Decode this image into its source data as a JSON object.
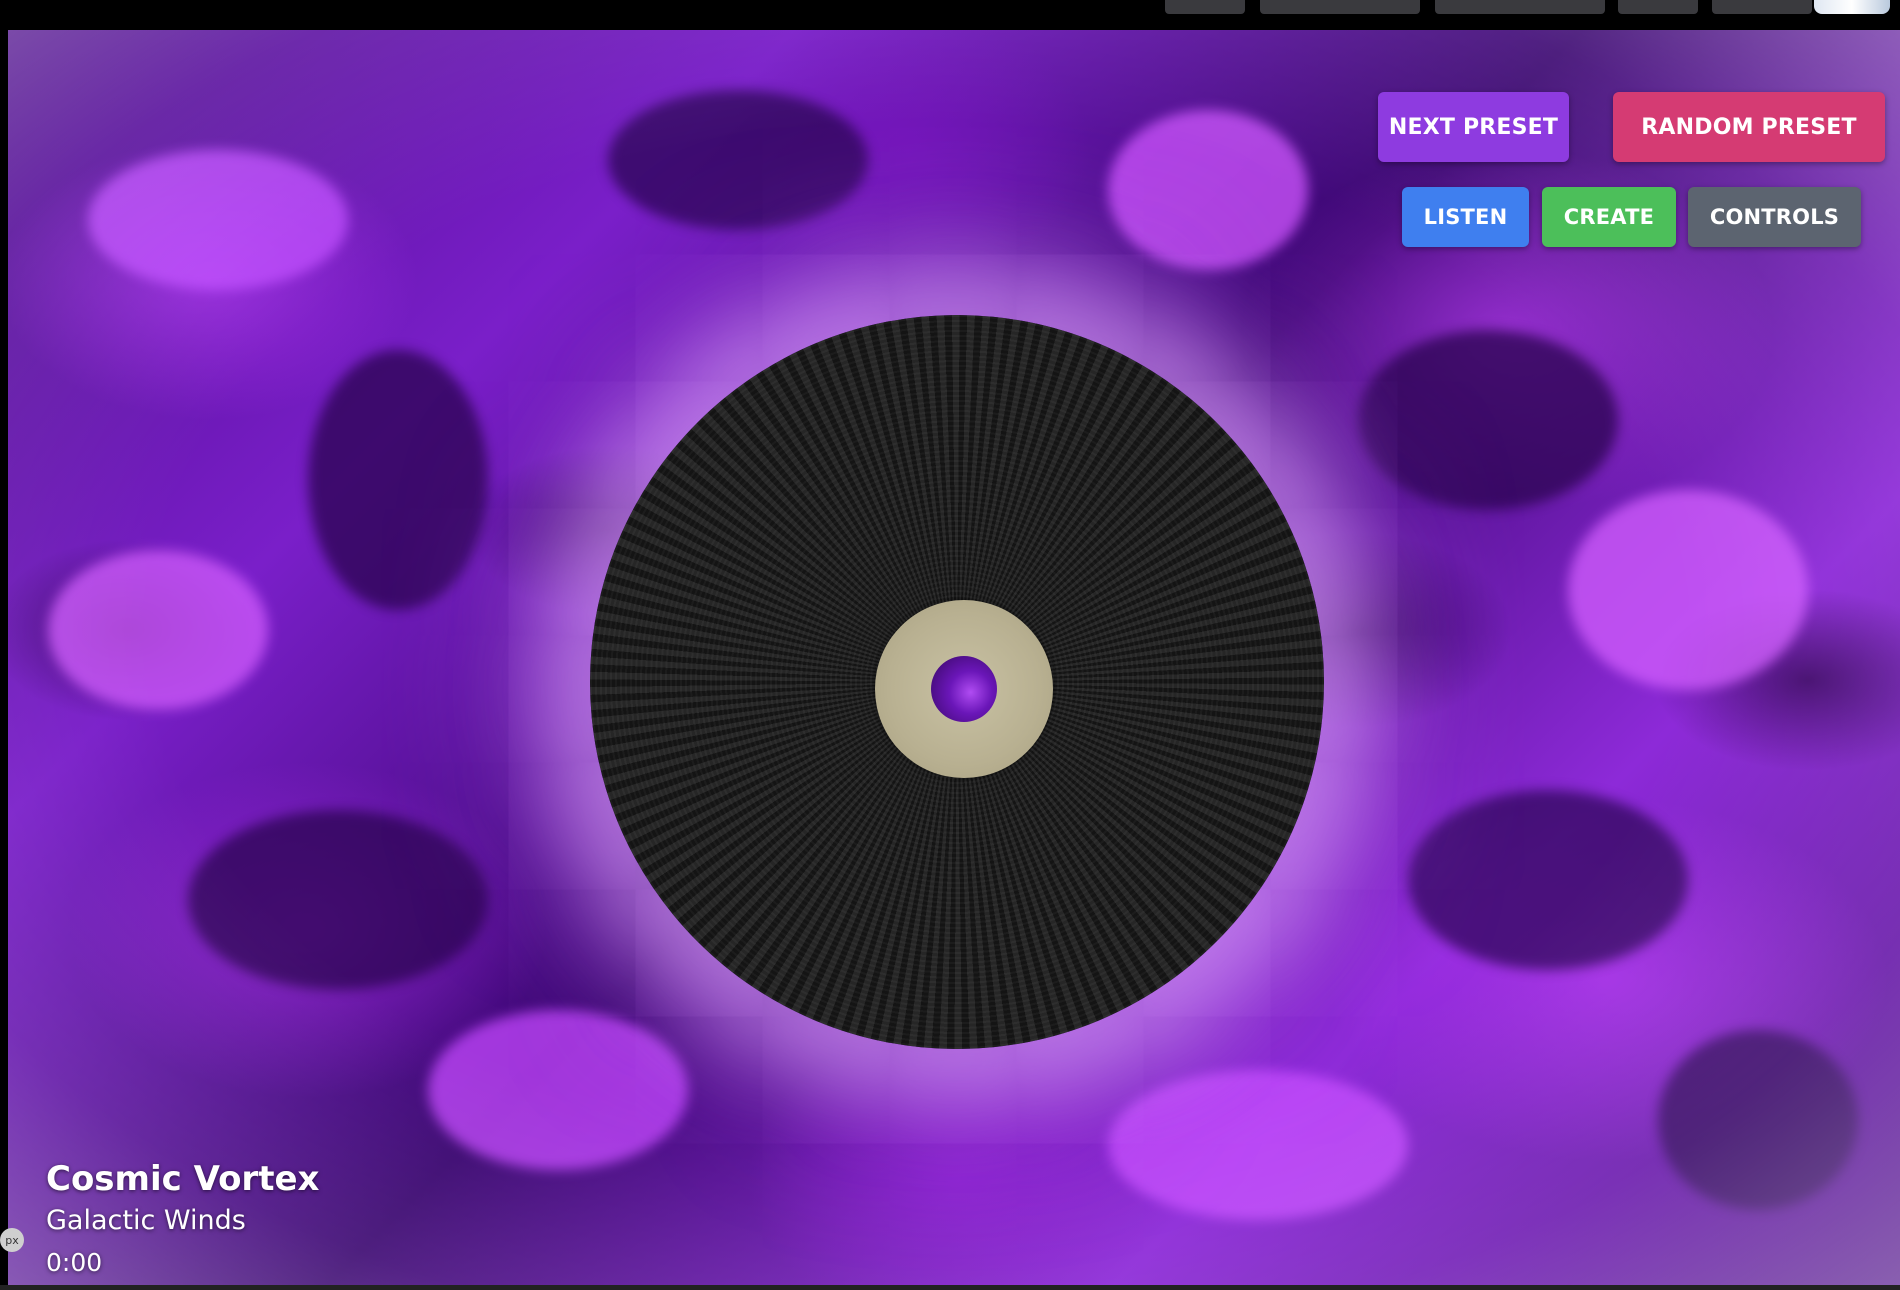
{
  "controls": {
    "next_preset_label": "NEXT PRESET",
    "random_preset_label": "RANDOM PRESET",
    "listen_label": "LISTEN",
    "create_label": "CREATE",
    "controls_label": "CONTROLS"
  },
  "now_playing": {
    "title": "Cosmic Vortex",
    "artist": "Galactic Winds",
    "time": "0:00"
  },
  "debug_badge": {
    "label": "px"
  },
  "colors": {
    "next_preset": "#8e3be0",
    "random_preset": "#d53b73",
    "listen": "#3f7fef",
    "create": "#4cbf5a",
    "controls": "#5c6470",
    "background_accent": "#8d2ad8"
  }
}
